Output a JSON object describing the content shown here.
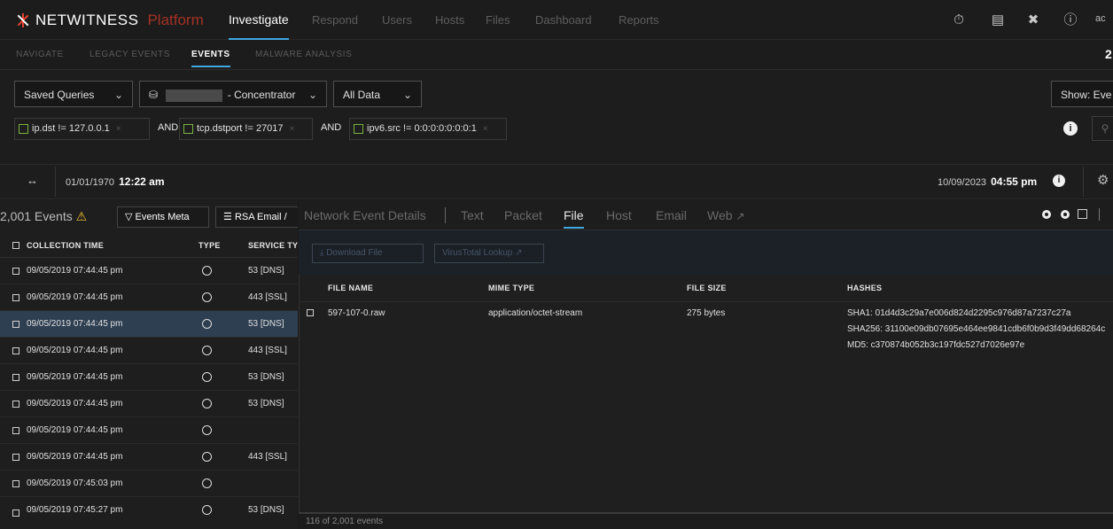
{
  "header": {
    "brand": "NETWITNESS",
    "product": "Platform",
    "nav": [
      "Investigate",
      "Respond",
      "Users",
      "Hosts",
      "Files",
      "Dashboard",
      "Reports"
    ],
    "user_initials": "ac"
  },
  "subtabs": [
    "NAVIGATE",
    "LEGACY EVENTS",
    "EVENTS",
    "MALWARE ANALYSIS"
  ],
  "subtab_badge": "2",
  "query": {
    "saved_queries": "Saved Queries",
    "service": "- Concentrator",
    "time_range": "All Data",
    "show_events": "Show: Eve",
    "pills": [
      "ip.dst != 127.0.0.1",
      "tcp.dstport != 27017",
      "ipv6.src != 0:0:0:0:0:0:0:1"
    ],
    "operator": "AND"
  },
  "timeline": {
    "start_date": "01/01/1970",
    "start_time": "12:22 am",
    "end_date": "10/09/2023",
    "end_time": "04:55 pm"
  },
  "events": {
    "count_label": "2,001 Events",
    "meta_button": "Events Meta",
    "rsa_button": "RSA Email /",
    "columns": [
      "COLLECTION TIME",
      "TYPE",
      "SERVICE TY"
    ],
    "rows": [
      {
        "time": "09/05/2019 07:44:45 pm",
        "service": "53 [DNS]"
      },
      {
        "time": "09/05/2019 07:44:45 pm",
        "service": "443 [SSL]"
      },
      {
        "time": "09/05/2019 07:44:45 pm",
        "service": "53 [DNS]"
      },
      {
        "time": "09/05/2019 07:44:45 pm",
        "service": "443 [SSL]"
      },
      {
        "time": "09/05/2019 07:44:45 pm",
        "service": "53 [DNS]"
      },
      {
        "time": "09/05/2019 07:44:45 pm",
        "service": "53 [DNS]"
      },
      {
        "time": "09/05/2019 07:44:45 pm",
        "service": ""
      },
      {
        "time": "09/05/2019 07:44:45 pm",
        "service": "443 [SSL]"
      },
      {
        "time": "09/05/2019 07:45:03 pm",
        "service": ""
      },
      {
        "time": "09/05/2019 07:45:27 pm",
        "service": "53 [DNS]"
      }
    ]
  },
  "detail": {
    "title": "Network Event Details",
    "tabs": [
      "Text",
      "Packet",
      "File",
      "Host",
      "Email",
      "Web"
    ],
    "download_button": "Download File",
    "virustotal_button": "VirusTotal Lookup",
    "columns": [
      "FILE NAME",
      "MIME TYPE",
      "FILE SIZE",
      "HASHES"
    ],
    "file": {
      "name": "597-107-0.raw",
      "mime": "application/octet-stream",
      "size": "275 bytes",
      "sha1": "SHA1: 01d4d3c29a7e006d824d2295c976d87a7237c27a",
      "sha256": "SHA256: 31100e09db07695e464ee9841cdb6f0b9d3f49dd68264c",
      "md5": "MD5: c370874b052b3c197fdc527d7026e97e"
    },
    "footer": "116 of 2,001 events"
  }
}
